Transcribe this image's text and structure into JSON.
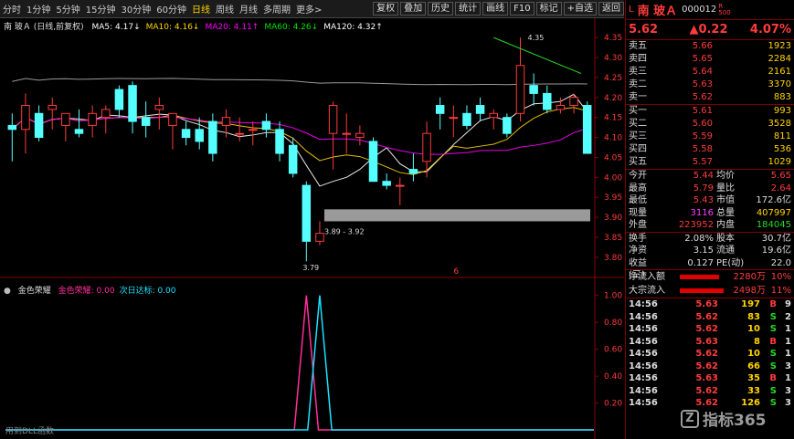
{
  "toolbar": {
    "periods": [
      "分时",
      "1分钟",
      "5分钟",
      "15分钟",
      "30分钟",
      "60分钟",
      "日线",
      "周线",
      "月线",
      "多周期",
      "更多>"
    ],
    "active_period": "日线",
    "buttons": [
      "复权",
      "叠加",
      "历史",
      "统计",
      "画线",
      "F10",
      "标记",
      "+自选",
      "返回"
    ]
  },
  "chart": {
    "title": "南 玻Ａ (日线,前复权)",
    "ma": [
      {
        "label": "MA5: 4.17↓",
        "color": "#ffffff"
      },
      {
        "label": "MA10: 4.16↓",
        "color": "#ffd400"
      },
      {
        "label": "MA20: 4.11↑",
        "color": "#ff00ff"
      },
      {
        "label": "MA60: 4.26↓",
        "color": "#00e000"
      },
      {
        "label": "MA120: 4.32↑",
        "color": "#ffffff"
      }
    ],
    "y_ticks": [
      "4.35",
      "4.30",
      "4.25",
      "4.20",
      "4.15",
      "4.10",
      "4.05",
      "4.00",
      "3.95",
      "3.90",
      "3.85",
      "3.80"
    ],
    "annotation_high": "4.35",
    "annotation_low": "3.79",
    "gap_label": "3.89 - 3.92",
    "marker": "6"
  },
  "indicator": {
    "name": "金色荣耀",
    "series": [
      {
        "label": "金色荣耀: 0.00",
        "color": "#ff2d9a"
      },
      {
        "label": "次日达标: 0.00",
        "color": "#19e3ff"
      }
    ],
    "y_ticks": [
      "1.00",
      "0.80",
      "0.60",
      "0.40",
      "0.20"
    ],
    "footer": "用到DLL函数"
  },
  "chart_data": {
    "type": "candlestick",
    "candles": [
      {
        "o": 4.13,
        "h": 4.16,
        "l": 4.04,
        "c": 4.12
      },
      {
        "o": 4.12,
        "h": 4.21,
        "l": 4.06,
        "c": 4.18
      },
      {
        "o": 4.16,
        "h": 4.18,
        "l": 4.09,
        "c": 4.1
      },
      {
        "o": 4.17,
        "h": 4.2,
        "l": 4.12,
        "c": 4.18
      },
      {
        "o": 4.13,
        "h": 4.15,
        "l": 4.09,
        "c": 4.16
      },
      {
        "o": 4.12,
        "h": 4.17,
        "l": 4.1,
        "c": 4.11
      },
      {
        "o": 4.13,
        "h": 4.18,
        "l": 4.1,
        "c": 4.16
      },
      {
        "o": 4.15,
        "h": 4.18,
        "l": 4.11,
        "c": 4.17
      },
      {
        "o": 4.22,
        "h": 4.23,
        "l": 4.15,
        "c": 4.17
      },
      {
        "o": 4.23,
        "h": 4.24,
        "l": 4.11,
        "c": 4.14
      },
      {
        "o": 4.15,
        "h": 4.19,
        "l": 4.1,
        "c": 4.13
      },
      {
        "o": 4.17,
        "h": 4.2,
        "l": 4.12,
        "c": 4.18
      },
      {
        "o": 4.13,
        "h": 4.16,
        "l": 4.07,
        "c": 4.16
      },
      {
        "o": 4.12,
        "h": 4.14,
        "l": 4.08,
        "c": 4.1
      },
      {
        "o": 4.12,
        "h": 4.15,
        "l": 4.07,
        "c": 4.09
      },
      {
        "o": 4.14,
        "h": 4.16,
        "l": 4.04,
        "c": 4.06
      },
      {
        "o": 4.13,
        "h": 4.17,
        "l": 4.1,
        "c": 4.15
      },
      {
        "o": 4.11,
        "h": 4.15,
        "l": 4.09,
        "c": 4.11
      },
      {
        "o": 4.12,
        "h": 4.14,
        "l": 4.08,
        "c": 4.12
      },
      {
        "o": 4.14,
        "h": 4.16,
        "l": 4.1,
        "c": 4.12
      },
      {
        "o": 4.12,
        "h": 4.14,
        "l": 4.04,
        "c": 4.06
      },
      {
        "o": 4.08,
        "h": 4.1,
        "l": 4.0,
        "c": 4.01
      },
      {
        "o": 3.98,
        "h": 3.99,
        "l": 3.79,
        "c": 3.84
      },
      {
        "o": 3.84,
        "h": 3.89,
        "l": 3.83,
        "c": 3.86
      },
      {
        "o": 4.11,
        "h": 4.19,
        "l": 4.02,
        "c": 4.18
      },
      {
        "o": 4.11,
        "h": 4.16,
        "l": 4.06,
        "c": 4.11
      },
      {
        "o": 4.1,
        "h": 4.13,
        "l": 4.08,
        "c": 4.11
      },
      {
        "o": 4.09,
        "h": 4.1,
        "l": 3.99,
        "c": 3.99
      },
      {
        "o": 3.99,
        "h": 4.01,
        "l": 3.97,
        "c": 3.98
      },
      {
        "o": 3.98,
        "h": 4.0,
        "l": 3.93,
        "c": 3.98
      },
      {
        "o": 4.02,
        "h": 4.06,
        "l": 3.99,
        "c": 4.01
      },
      {
        "o": 4.04,
        "h": 4.14,
        "l": 4.0,
        "c": 4.11
      },
      {
        "o": 4.18,
        "h": 4.2,
        "l": 4.12,
        "c": 4.16
      },
      {
        "o": 4.15,
        "h": 4.18,
        "l": 4.1,
        "c": 4.15
      },
      {
        "o": 4.16,
        "h": 4.18,
        "l": 4.12,
        "c": 4.13
      },
      {
        "o": 4.18,
        "h": 4.2,
        "l": 4.14,
        "c": 4.16
      },
      {
        "o": 4.15,
        "h": 4.17,
        "l": 4.12,
        "c": 4.16
      },
      {
        "o": 4.15,
        "h": 4.16,
        "l": 4.1,
        "c": 4.11
      },
      {
        "o": 4.16,
        "h": 4.35,
        "l": 4.14,
        "c": 4.28
      },
      {
        "o": 4.23,
        "h": 4.26,
        "l": 4.18,
        "c": 4.21
      },
      {
        "o": 4.21,
        "h": 4.23,
        "l": 4.16,
        "c": 4.17
      },
      {
        "o": 4.17,
        "h": 4.2,
        "l": 4.16,
        "c": 4.18
      },
      {
        "o": 4.18,
        "h": 4.21,
        "l": 4.16,
        "c": 4.2
      },
      {
        "o": 4.18,
        "h": 4.19,
        "l": 4.06,
        "c": 4.06
      }
    ],
    "ylim": [
      3.77,
      4.38
    ],
    "indicator_ylim": [
      0,
      1.1
    ],
    "spikes": [
      {
        "series": "金色荣耀",
        "index": 22,
        "value": 1.0
      },
      {
        "series": "次日达标",
        "index": 23,
        "value": 1.0
      }
    ]
  },
  "quote": {
    "prefix": "L",
    "name": "南 玻Ａ",
    "code": "000012",
    "rr_top": "R",
    "rr_bottom": "500",
    "price": "5.62",
    "change": "▲0.22",
    "pct": "4.07%",
    "sells": [
      {
        "label": "卖五",
        "price": "5.66",
        "vol": "1923"
      },
      {
        "label": "卖四",
        "price": "5.65",
        "vol": "2284"
      },
      {
        "label": "卖三",
        "price": "5.64",
        "vol": "2161"
      },
      {
        "label": "卖二",
        "price": "5.63",
        "vol": "3370"
      },
      {
        "label": "卖一",
        "price": "5.62",
        "vol": "883"
      }
    ],
    "buys": [
      {
        "label": "买一",
        "price": "5.61",
        "vol": "993"
      },
      {
        "label": "买二",
        "price": "5.60",
        "vol": "3528"
      },
      {
        "label": "买三",
        "price": "5.59",
        "vol": "811"
      },
      {
        "label": "买四",
        "price": "5.58",
        "vol": "536"
      },
      {
        "label": "买五",
        "price": "5.57",
        "vol": "1029"
      }
    ],
    "stats1": [
      {
        "k1": "今开",
        "v1": "5.44",
        "c1": "#ff3b3b",
        "k2": "均价",
        "v2": "5.65",
        "c2": "#ff3b3b"
      },
      {
        "k1": "最高",
        "v1": "5.79",
        "c1": "#ff3b3b",
        "k2": "量比",
        "v2": "2.64",
        "c2": "#ff3b3b"
      },
      {
        "k1": "最低",
        "v1": "5.43",
        "c1": "#ff3b3b",
        "k2": "市值",
        "v2": "172.6亿",
        "c2": "#dddddd"
      },
      {
        "k1": "现量",
        "v1": "3116",
        "c1": "#ff3bff",
        "k2": "总量",
        "v2": "407997",
        "c2": "#ffd400"
      },
      {
        "k1": "外盘",
        "v1": "223952",
        "c1": "#ff3b3b",
        "k2": "内盘",
        "v2": "184045",
        "c2": "#27d827"
      }
    ],
    "stats2": [
      {
        "k1": "换手",
        "v1": "2.08%",
        "c1": "#dddddd",
        "k2": "股本",
        "v2": "30.7亿",
        "c2": "#dddddd"
      },
      {
        "k1": "净资",
        "v1": "3.15",
        "c1": "#dddddd",
        "k2": "流通",
        "v2": "19.6亿",
        "c2": "#dddddd"
      },
      {
        "k1": "收益(三)",
        "v1": "0.127",
        "c1": "#dddddd",
        "k2": "PE(动)",
        "v2": "22.0",
        "c2": "#dddddd"
      }
    ],
    "flows": [
      {
        "label": "净流入额",
        "value": "2280万",
        "pct": "10%",
        "bar": 0.62
      },
      {
        "label": "大宗流入",
        "value": "2498万",
        "pct": "11%",
        "bar": 0.68
      }
    ],
    "ticks": [
      {
        "t": "14:56",
        "p": "5.63",
        "v": "197",
        "s": "B",
        "sc": "#ff3b3b",
        "n": "9"
      },
      {
        "t": "14:56",
        "p": "5.62",
        "v": "83",
        "s": "S",
        "sc": "#27d827",
        "n": "2"
      },
      {
        "t": "14:56",
        "p": "5.62",
        "v": "10",
        "s": "S",
        "sc": "#27d827",
        "n": "1"
      },
      {
        "t": "14:56",
        "p": "5.63",
        "v": "8",
        "s": "B",
        "sc": "#ff3b3b",
        "n": "1"
      },
      {
        "t": "14:56",
        "p": "5.62",
        "v": "10",
        "s": "S",
        "sc": "#27d827",
        "n": "1"
      },
      {
        "t": "14:56",
        "p": "5.62",
        "v": "66",
        "s": "S",
        "sc": "#27d827",
        "n": "3"
      },
      {
        "t": "14:56",
        "p": "5.63",
        "v": "35",
        "s": "B",
        "sc": "#ff3b3b",
        "n": "1"
      },
      {
        "t": "14:56",
        "p": "5.62",
        "v": "33",
        "s": "S",
        "sc": "#27d827",
        "n": "3"
      },
      {
        "t": "14:56",
        "p": "5.62",
        "v": "126",
        "s": "S",
        "sc": "#27d827",
        "n": "3"
      }
    ]
  },
  "watermark": {
    "logo": "Z",
    "text": "指标365"
  }
}
